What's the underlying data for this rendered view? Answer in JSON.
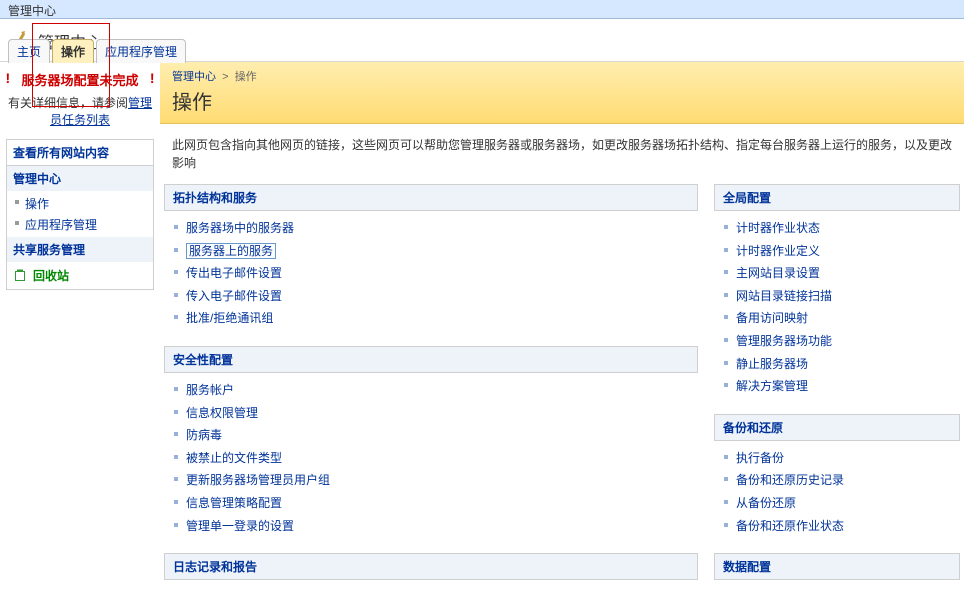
{
  "topbar_title": "管理中心",
  "header_title": "管理中心",
  "tabs": {
    "home": "主页",
    "ops": "操作",
    "apps": "应用程序管理"
  },
  "breadcrumb": {
    "root": "管理中心",
    "sep": ">",
    "current": "操作"
  },
  "page_heading": "操作",
  "description": "此网页包含指向其他网页的链接，这些网页可以帮助您管理服务器或服务器场，如更改服务器场拓扑结构、指定每台服务器上运行的服务，以及更改影响",
  "sidebar": {
    "warning_title": "服务器场配置未完成",
    "warning_sub_prefix": "有关详细信息，请参阅",
    "warning_link": "管理员任务列表",
    "view_all": "查看所有网站内容",
    "group_admin": "管理中心",
    "items_admin": [
      "操作",
      "应用程序管理"
    ],
    "group_shared": "共享服务管理",
    "recycle": "回收站"
  },
  "left_col": {
    "topology": {
      "title": "拓扑结构和服务",
      "items": [
        "服务器场中的服务器",
        "服务器上的服务",
        "传出电子邮件设置",
        "传入电子邮件设置",
        "批准/拒绝通讯组"
      ]
    },
    "security": {
      "title": "安全性配置",
      "items": [
        "服务帐户",
        "信息权限管理",
        "防病毒",
        "被禁止的文件类型",
        "更新服务器场管理员用户组",
        "信息管理策略配置",
        "管理单一登录的设置"
      ]
    },
    "logging": {
      "title": "日志记录和报告"
    }
  },
  "right_col": {
    "global": {
      "title": "全局配置",
      "items": [
        "计时器作业状态",
        "计时器作业定义",
        "主网站目录设置",
        "网站目录链接扫描",
        "备用访问映射",
        "管理服务器场功能",
        "静止服务器场",
        "解决方案管理"
      ]
    },
    "backup": {
      "title": "备份和还原",
      "items": [
        "执行备份",
        "备份和还原历史记录",
        "从备份还原",
        "备份和还原作业状态"
      ]
    },
    "data": {
      "title": "数据配置"
    }
  }
}
